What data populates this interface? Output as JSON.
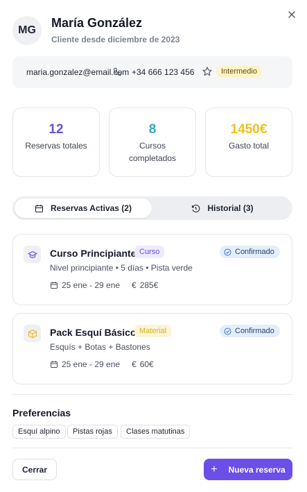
{
  "customer": {
    "initials": "MG",
    "name": "María González",
    "since": "Cliente desde diciembre de 2023"
  },
  "contact": {
    "email": "maria.gonzalez@email.com",
    "phone": "+34 666 123 456",
    "level": "Intermedio"
  },
  "stats": [
    {
      "value": "12",
      "label": "Reservas totales",
      "color": "#6b4fe0"
    },
    {
      "value": "8",
      "label": "Cursos completados",
      "color": "#3aa5c2"
    },
    {
      "value": "1450€",
      "label": "Gasto total",
      "color": "#f0c020"
    }
  ],
  "tabs": {
    "active": "Reservas Activas (2)",
    "history": "Historial (3)"
  },
  "bookings": [
    {
      "icon": "graduation-cap-icon",
      "title": "Curso Principiante",
      "tag": "Curso",
      "status": "Confirmado",
      "description": "Nivel principiante • 5 días • Pista verde",
      "dates": "25 ene - 29 ene",
      "price_symbol": "€",
      "price": "285€"
    },
    {
      "icon": "package-icon",
      "title": "Pack Esquí Básico",
      "tag": "Material",
      "status": "Confirmado",
      "description": "Esquís + Botas + Bastones",
      "dates": "25 ene - 29 ene",
      "price_symbol": "€",
      "price": "60€"
    }
  ],
  "preferences": {
    "title": "Preferencias",
    "items": [
      "Esquí alpino",
      "Pistas rojas",
      "Clases matutinas"
    ]
  },
  "footer": {
    "close_label": "Cerrar",
    "new_label": "Nueva reserva",
    "new_icon": "+"
  },
  "colors": {
    "accent": "#6b4fe8",
    "status_bg": "#e3eefc",
    "level_bg": "#fdf3c6"
  }
}
